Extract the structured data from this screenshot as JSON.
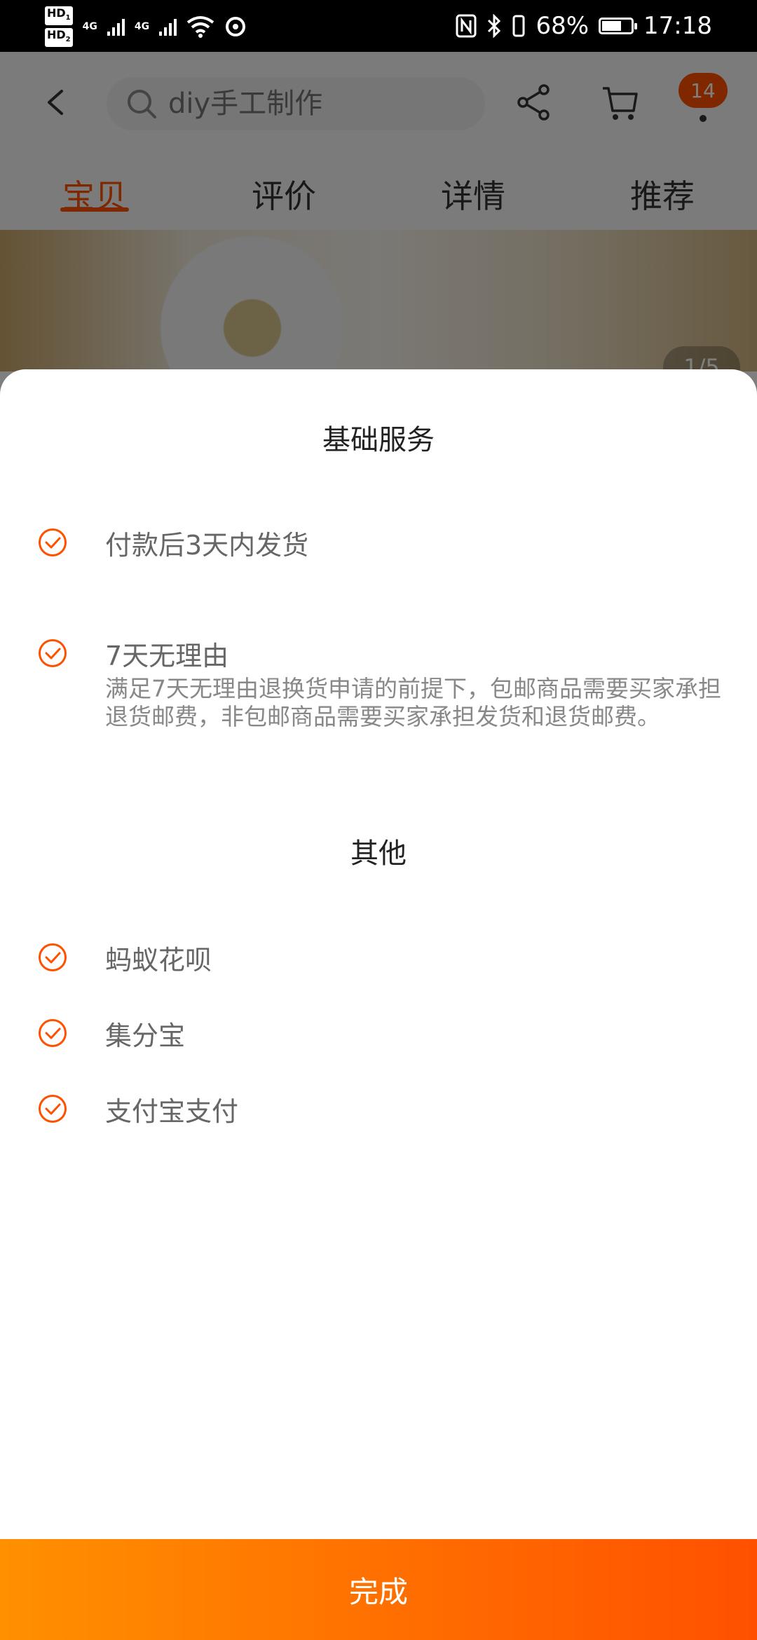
{
  "status_bar": {
    "hd1": "HD",
    "hd1_sub": "1",
    "hd2": "HD",
    "hd2_sub": "2",
    "net1": "4G",
    "net2": "4G",
    "battery_percent": "68%",
    "battery_level": 0.68,
    "time": "17:18",
    "icons": [
      "signal-icon",
      "wifi-icon",
      "hotspot-icon",
      "nfc-icon",
      "bluetooth-icon",
      "vibrate-icon",
      "battery-icon"
    ]
  },
  "background_page": {
    "search_placeholder": "diy手工制作",
    "cart_badge": "14",
    "tabs": [
      "宝贝",
      "评价",
      "详情",
      "推荐"
    ],
    "active_tab_index": 0,
    "image_counter": "1/5"
  },
  "sheet": {
    "basic_section_title": "基础服务",
    "basic_items": [
      {
        "title": "付款后3天内发货",
        "description": ""
      },
      {
        "title": "7天无理由",
        "description": "满足7天无理由退换货申请的前提下，包邮商品需要买家承担退货邮费，非包邮商品需要买家承担发货和退货邮费。"
      }
    ],
    "other_section_title": "其他",
    "other_items": [
      {
        "title": "蚂蚁花呗"
      },
      {
        "title": "集分宝"
      },
      {
        "title": "支付宝支付"
      }
    ],
    "done_label": "完成"
  },
  "colors": {
    "accent": "#ff5000",
    "gradient_start": "#ff9000",
    "gradient_end": "#ff5000",
    "overlay": "rgba(0,0,0,0.5)"
  }
}
